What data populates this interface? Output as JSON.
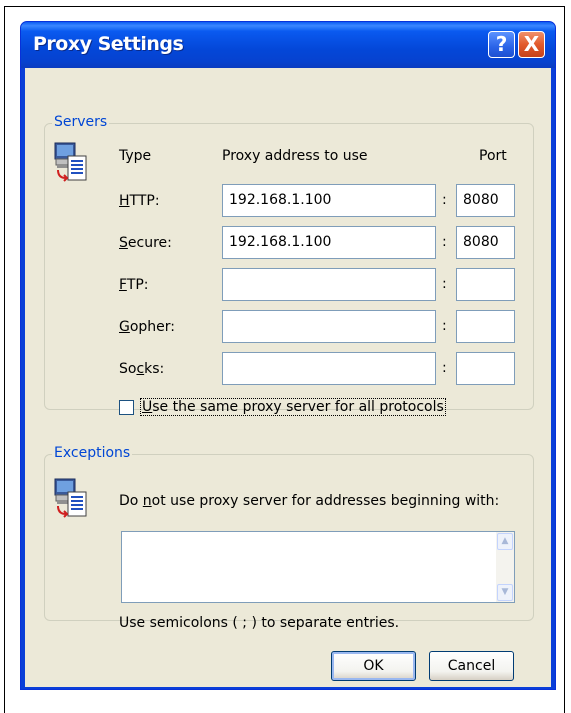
{
  "window": {
    "title": "Proxy Settings",
    "help_symbol": "?",
    "close_symbol": "X"
  },
  "servers": {
    "legend": "Servers",
    "icon": "network-computer-icon",
    "headers": {
      "type": "Type",
      "address": "Proxy address to use",
      "port": "Port"
    },
    "rows": [
      {
        "label_pre": "",
        "label_key": "H",
        "label_post": "TTP:",
        "address": "192.168.1.100",
        "port": "8080"
      },
      {
        "label_pre": "",
        "label_key": "S",
        "label_post": "ecure:",
        "address": "192.168.1.100",
        "port": "8080"
      },
      {
        "label_pre": "",
        "label_key": "F",
        "label_post": "TP:",
        "address": "",
        "port": ""
      },
      {
        "label_pre": "",
        "label_key": "G",
        "label_post": "opher:",
        "address": "",
        "port": ""
      },
      {
        "label_pre": "So",
        "label_key": "c",
        "label_post": "ks:",
        "address": "",
        "port": ""
      }
    ],
    "same_proxy": {
      "checked": false,
      "label_key": "U",
      "label_post": "se the same proxy server for all protocols"
    }
  },
  "exceptions": {
    "legend": "Exceptions",
    "icon": "network-computer-icon",
    "label_pre": "Do ",
    "label_key": "n",
    "label_post": "ot use proxy server for addresses beginning with:",
    "value": "",
    "hint": "Use semicolons ( ; ) to separate entries."
  },
  "buttons": {
    "ok": "OK",
    "cancel": "Cancel"
  }
}
